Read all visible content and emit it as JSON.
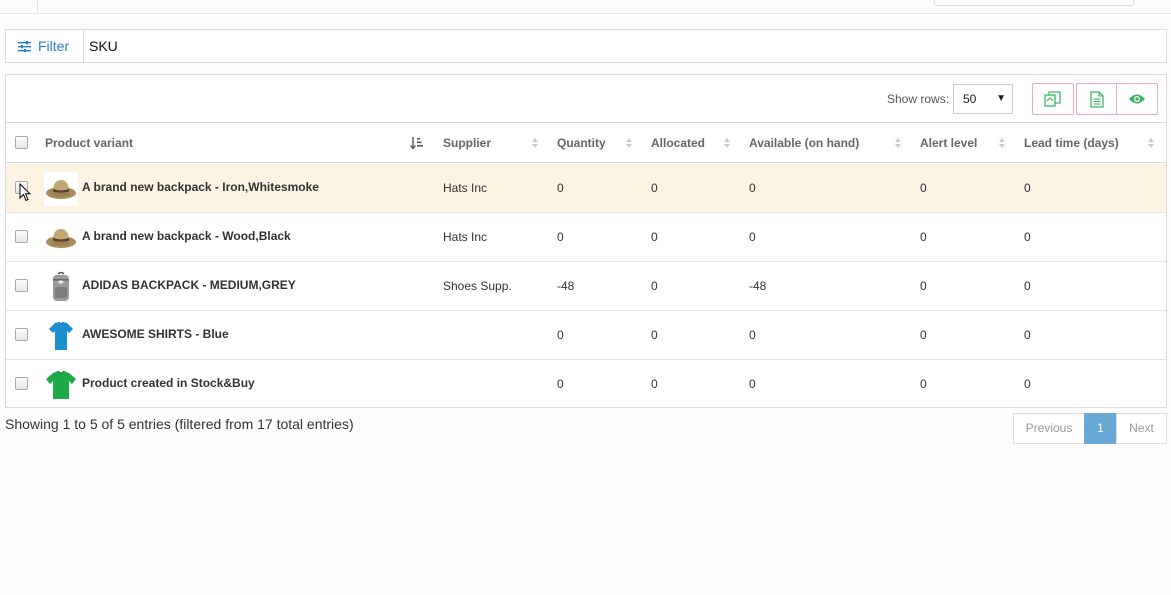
{
  "filter": {
    "label": "Filter",
    "field": "SKU"
  },
  "toolbar": {
    "show_rows_label": "Show rows:",
    "rows_value": "50",
    "buttons": [
      "copy-icon",
      "document-icon",
      "eye-icon"
    ]
  },
  "table": {
    "headers": [
      "Product variant",
      "Supplier",
      "Quantity",
      "Allocated",
      "Available (on hand)",
      "Alert level",
      "Lead time (days)"
    ],
    "rows": [
      {
        "thumb": "hat-icon",
        "name": "A brand new backpack - Iron,Whitesmoke",
        "supplier": "Hats Inc",
        "quantity": "0",
        "allocated": "0",
        "available": "0",
        "alert": "0",
        "lead": "0"
      },
      {
        "thumb": "hat-icon",
        "name": "A brand new backpack - Wood,Black",
        "supplier": "Hats Inc",
        "quantity": "0",
        "allocated": "0",
        "available": "0",
        "alert": "0",
        "lead": "0"
      },
      {
        "thumb": "backpack-icon",
        "name": "ADIDAS BACKPACK - MEDIUM,GREY",
        "supplier": "Shoes Supp.",
        "quantity": "-48",
        "allocated": "0",
        "available": "-48",
        "alert": "0",
        "lead": "0"
      },
      {
        "thumb": "blue-shirt-icon",
        "name": "AWESOME SHIRTS - Blue",
        "supplier": "",
        "quantity": "0",
        "allocated": "0",
        "available": "0",
        "alert": "0",
        "lead": "0"
      },
      {
        "thumb": "green-shirt-icon",
        "name": "Product created in Stock&Buy",
        "supplier": "",
        "quantity": "0",
        "allocated": "0",
        "available": "0",
        "alert": "0",
        "lead": "0"
      }
    ]
  },
  "footer": {
    "summary": "Showing 1 to 5 of 5 entries (filtered from 17 total entries)",
    "previous": "Previous",
    "page": "1",
    "next": "Next"
  },
  "colors": {
    "accent": "#2a7fc1",
    "highlight_row": "#fdf3e3",
    "active_page": "#6aa9d6",
    "tool_button_border": "#e7a8d8",
    "tool_icon": "#3cb563"
  }
}
